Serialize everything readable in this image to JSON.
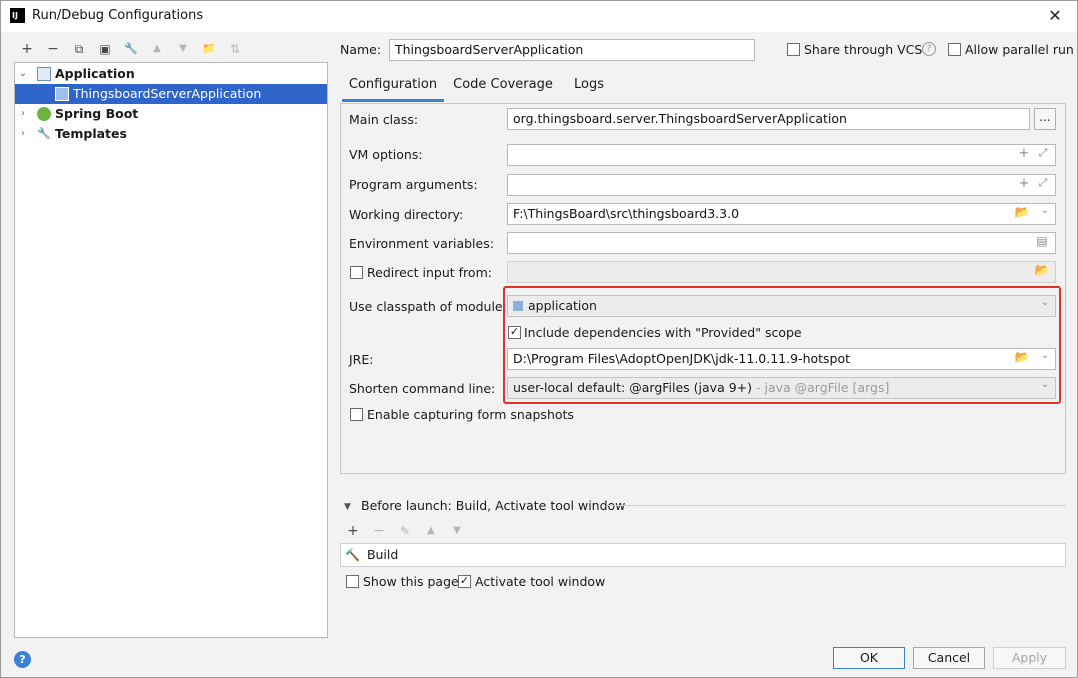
{
  "window": {
    "title": "Run/Debug Configurations",
    "app_icon_text": "IJ",
    "close_glyph": "✕"
  },
  "toolbar": {
    "icons": [
      {
        "name": "add-icon",
        "glyph": "+",
        "enabled": true
      },
      {
        "name": "remove-icon",
        "glyph": "−",
        "enabled": true
      },
      {
        "name": "copy-icon",
        "glyph": "⧉",
        "enabled": true
      },
      {
        "name": "save-icon",
        "glyph": "▣",
        "enabled": true
      },
      {
        "name": "wrench-icon",
        "glyph": "🔧",
        "enabled": true
      },
      {
        "name": "move-up-icon",
        "glyph": "▲",
        "enabled": false
      },
      {
        "name": "move-down-icon",
        "glyph": "▼",
        "enabled": false
      },
      {
        "name": "folder-add-icon",
        "glyph": "📁",
        "enabled": true
      },
      {
        "name": "sort-icon",
        "glyph": "⇅",
        "enabled": false
      }
    ]
  },
  "tree": {
    "items": [
      {
        "label": "Application",
        "bold": true,
        "expanded": true
      },
      {
        "label": "ThingsboardServerApplication",
        "bold": false,
        "selected": true
      },
      {
        "label": "Spring Boot",
        "bold": true,
        "expanded": false
      },
      {
        "label": "Templates",
        "bold": true,
        "expanded": false
      }
    ]
  },
  "name_row": {
    "label": "Name:",
    "value": "ThingsboardServerApplication",
    "share_label": "Share through VCS",
    "parallel_label": "Allow parallel run"
  },
  "tabs": [
    {
      "label": "Configuration",
      "active": true
    },
    {
      "label": "Code Coverage",
      "active": false
    },
    {
      "label": "Logs",
      "active": false
    }
  ],
  "form": {
    "main_class_label": "Main class:",
    "main_class_value": "org.thingsboard.server.ThingsboardServerApplication",
    "dots_label": "...",
    "vm_options_label": "VM options:",
    "vm_options_value": "",
    "program_args_label": "Program arguments:",
    "program_args_value": "",
    "working_dir_label": "Working directory:",
    "working_dir_value": "F:\\ThingsBoard\\src\\thingsboard3.3.0",
    "env_vars_label": "Environment variables:",
    "env_vars_value": "",
    "redirect_label": "Redirect input from:",
    "classpath_label": "Use classpath of module:",
    "classpath_value": "application",
    "include_deps_label": "Include dependencies with \"Provided\" scope",
    "jre_label": "JRE:",
    "jre_value": "D:\\Program Files\\AdoptOpenJDK\\jdk-11.0.11.9-hotspot",
    "shorten_label": "Shorten command line:",
    "shorten_value": "user-local default: @argFiles (java 9+)",
    "shorten_hint": "- java @argFile [args]",
    "enable_snapshots_label": "Enable capturing form snapshots"
  },
  "before_launch": {
    "header": "Before launch: Build, Activate tool window",
    "items": [
      "Build"
    ],
    "show_page_label": "Show this page",
    "activate_label": "Activate tool window"
  },
  "buttons": {
    "ok": "OK",
    "cancel": "Cancel",
    "apply": "Apply",
    "help": "?"
  },
  "colors": {
    "selection": "#2f65ca",
    "highlight_border": "#e0312a",
    "tab_underline": "#4083c9"
  }
}
